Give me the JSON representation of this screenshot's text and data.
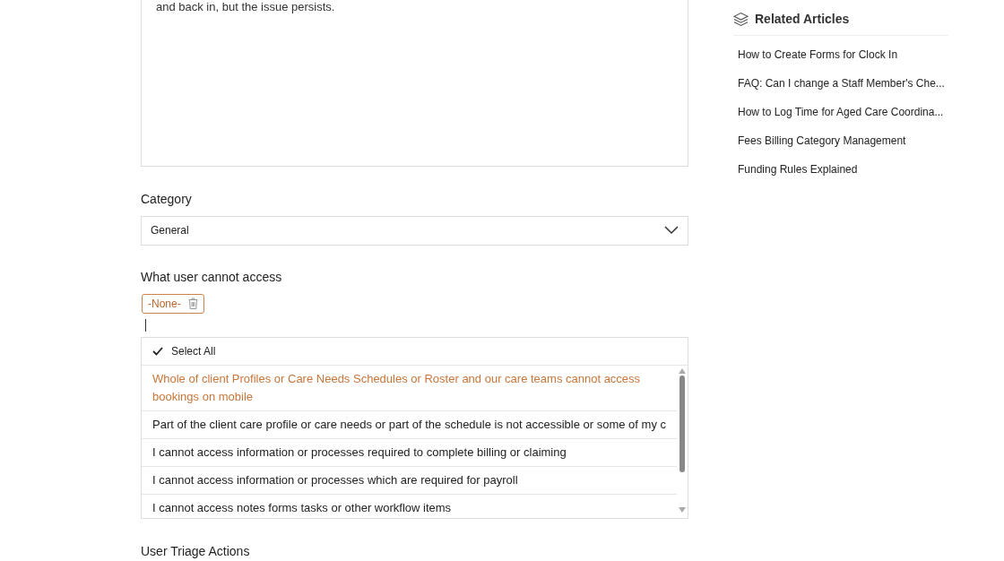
{
  "description": {
    "value": "and back in, but the issue persists."
  },
  "category": {
    "label": "Category",
    "value": "General"
  },
  "access": {
    "label": "What user cannot access",
    "tags": [
      "-None-"
    ],
    "select_all": {
      "label": "Select All",
      "checked": true
    },
    "options": [
      {
        "label": "Whole of client Profiles or Care Needs Schedules or Roster and our care teams cannot access bookings on mobile",
        "selected": true
      },
      {
        "label": "Part of the client care profile or care needs or part of the schedule is not accessible or some of my c",
        "selected": false
      },
      {
        "label": "I cannot access information or processes required to complete billing or claiming",
        "selected": false
      },
      {
        "label": "I cannot access information or processes which are required for payroll",
        "selected": false
      },
      {
        "label": "I cannot access notes forms tasks or other workflow items",
        "selected": false
      }
    ]
  },
  "triage": {
    "label": "User Triage Actions"
  },
  "related": {
    "title": "Related Articles",
    "items": [
      "How to Create Forms for Clock In",
      "FAQ: Can I change a Staff Member's Che...",
      "How to Log Time for Aged Care Coordina...",
      "Fees Billing Category Management",
      "Funding Rules Explained"
    ]
  }
}
